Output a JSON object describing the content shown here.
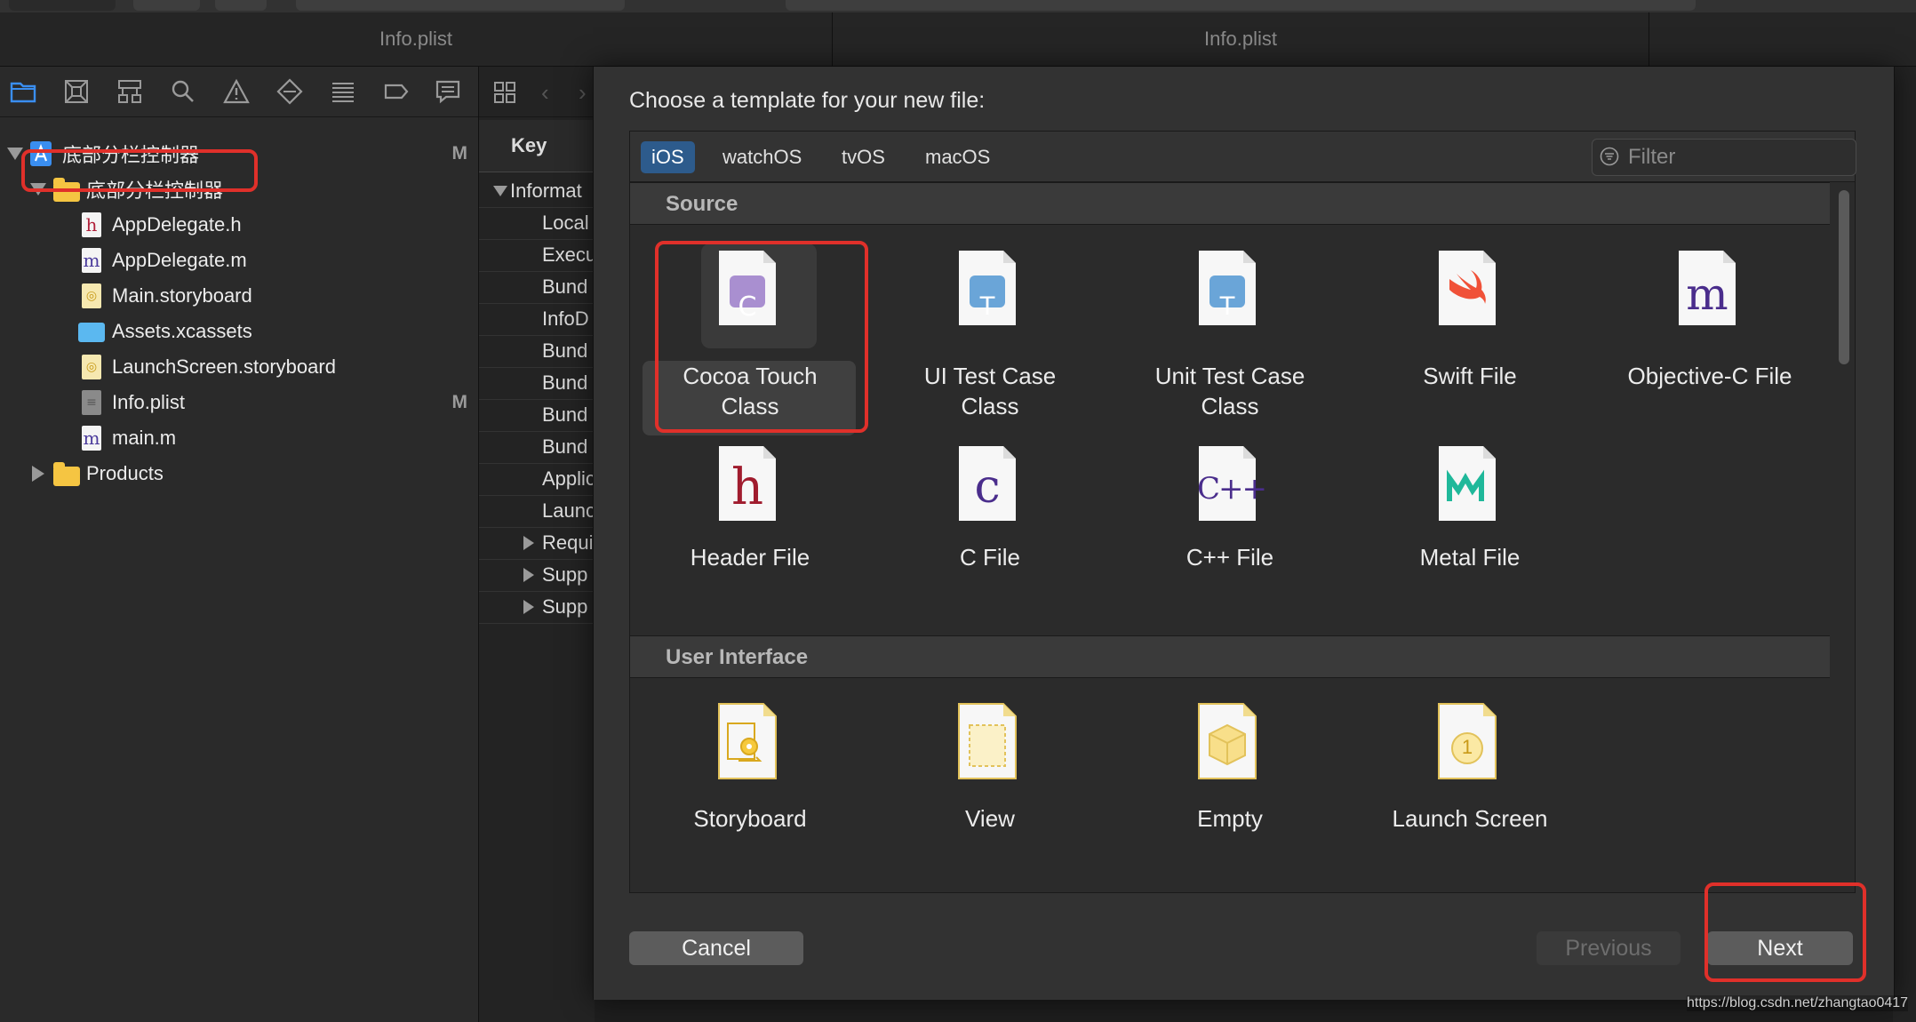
{
  "tabs": [
    "Info.plist",
    "Info.plist"
  ],
  "navigator": {
    "toolbar_icons": [
      "folder-icon",
      "source-control-icon",
      "hierarchy-icon",
      "search-icon",
      "warning-icon",
      "test-icon",
      "debug-icon",
      "breakpoint-icon",
      "report-icon"
    ],
    "tree": [
      {
        "label": "底部分栏控制器",
        "kind": "project",
        "badge": "M"
      },
      {
        "label": "底部分栏控制器",
        "kind": "group"
      },
      {
        "label": "AppDelegate.h",
        "kind": "h-file"
      },
      {
        "label": "AppDelegate.m",
        "kind": "m-file"
      },
      {
        "label": "Main.storyboard",
        "kind": "storyboard"
      },
      {
        "label": "Assets.xcassets",
        "kind": "assets"
      },
      {
        "label": "LaunchScreen.storyboard",
        "kind": "storyboard"
      },
      {
        "label": "Info.plist",
        "kind": "plist",
        "badge": "M"
      },
      {
        "label": "main.m",
        "kind": "m-file"
      },
      {
        "label": "Products",
        "kind": "group"
      }
    ]
  },
  "plist": {
    "header": "Key",
    "rows": [
      "Informat",
      "Local",
      "Execu",
      "Bund",
      "InfoD",
      "Bund",
      "Bund",
      "Bund",
      "Bund",
      "Applic",
      "Launc",
      "Requi",
      "Supp",
      "Supp"
    ]
  },
  "sheet": {
    "title": "Choose a template for your new file:",
    "platforms": [
      "iOS",
      "watchOS",
      "tvOS",
      "macOS"
    ],
    "active_platform": "iOS",
    "filter_placeholder": "Filter",
    "sections": [
      {
        "title": "Source",
        "templates": [
          {
            "label": "Cocoa Touch\nClass",
            "icon": "cocoa-touch-class-icon",
            "glyph": "C",
            "selected": true
          },
          {
            "label": "UI Test Case\nClass",
            "icon": "ui-test-case-icon",
            "glyph": "T"
          },
          {
            "label": "Unit Test Case\nClass",
            "icon": "unit-test-case-icon",
            "glyph": "T"
          },
          {
            "label": "Swift File",
            "icon": "swift-icon",
            "glyph": ""
          },
          {
            "label": "Objective-C File",
            "icon": "objective-c-icon",
            "glyph": "m"
          },
          {
            "label": "Header File",
            "icon": "header-file-icon",
            "glyph": "h"
          },
          {
            "label": "C File",
            "icon": "c-file-icon",
            "glyph": "c"
          },
          {
            "label": "C++ File",
            "icon": "cpp-file-icon",
            "glyph": "C++"
          },
          {
            "label": "Metal File",
            "icon": "metal-icon",
            "glyph": ""
          }
        ]
      },
      {
        "title": "User Interface",
        "templates": [
          {
            "label": "Storyboard",
            "icon": "storyboard-icon",
            "glyph": ""
          },
          {
            "label": "View",
            "icon": "view-icon",
            "glyph": ""
          },
          {
            "label": "Empty",
            "icon": "empty-icon",
            "glyph": ""
          },
          {
            "label": "Launch Screen",
            "icon": "launch-screen-icon",
            "glyph": "1"
          }
        ]
      }
    ],
    "buttons": {
      "cancel": "Cancel",
      "previous": "Previous",
      "next": "Next"
    }
  },
  "watermark": "https://blog.csdn.net/zhangtao0417",
  "colors": {
    "highlight": "#e0302a",
    "accent": "#2d5b8c"
  }
}
